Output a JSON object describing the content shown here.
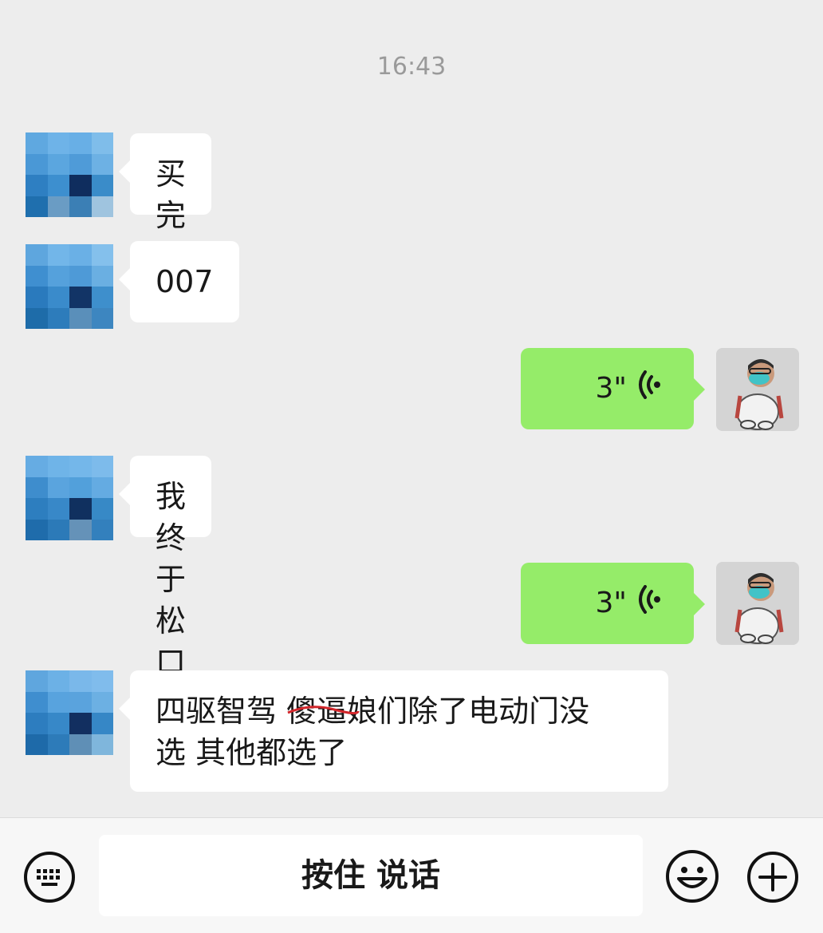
{
  "chat": {
    "timestamp": "16:43",
    "messages": [
      {
        "side": "in",
        "type": "text",
        "text": "买完了"
      },
      {
        "side": "in",
        "type": "text",
        "text": "007"
      },
      {
        "side": "out",
        "type": "voice",
        "duration": "3\""
      },
      {
        "side": "in",
        "type": "text",
        "text": "我终于松口气"
      },
      {
        "side": "out",
        "type": "voice",
        "duration": "3\""
      },
      {
        "side": "in",
        "type": "text",
        "line1_a": "四驱智驾 ",
        "line1_strike": "傻逼",
        "line1_b": "娘们除了电动门没",
        "line2": "选 其他都选了"
      }
    ]
  },
  "inputbar": {
    "hold_to_talk_label": "按住 说话",
    "icons": [
      "keyboard-icon",
      "emoji-icon",
      "plus-icon"
    ]
  },
  "colors": {
    "background": "#ededed",
    "outgoing_bubble": "#95ec69",
    "incoming_bubble": "#ffffff"
  }
}
